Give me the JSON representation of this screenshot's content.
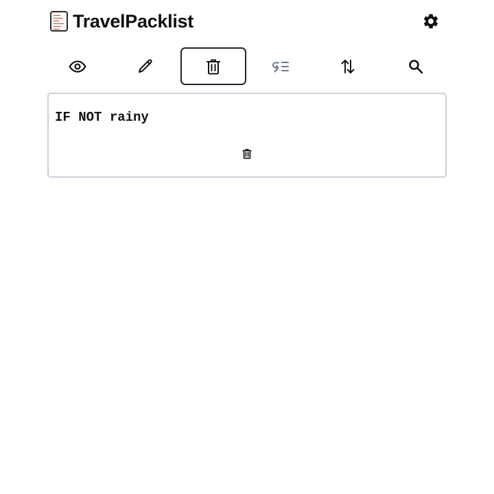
{
  "app": {
    "title": "TravelPacklist"
  },
  "toolbar": {
    "tools": [
      {
        "name": "view",
        "icon": "eye-icon",
        "active": false
      },
      {
        "name": "edit",
        "icon": "pencil-icon",
        "active": false
      },
      {
        "name": "delete",
        "icon": "trash-icon",
        "active": true
      },
      {
        "name": "conditions",
        "icon": "conditional-list-icon",
        "active": false,
        "color": "#6b7a90"
      },
      {
        "name": "sort",
        "icon": "sort-arrows-icon",
        "active": false
      },
      {
        "name": "search",
        "icon": "search-icon",
        "active": false
      }
    ]
  },
  "items": [
    {
      "condition": "IF NOT rainy",
      "delete_icon": "trash-icon"
    }
  ],
  "colors": {
    "active_border": "#1e2530",
    "card_border": "#c9d1da",
    "muted_icon": "#6b7a90"
  }
}
